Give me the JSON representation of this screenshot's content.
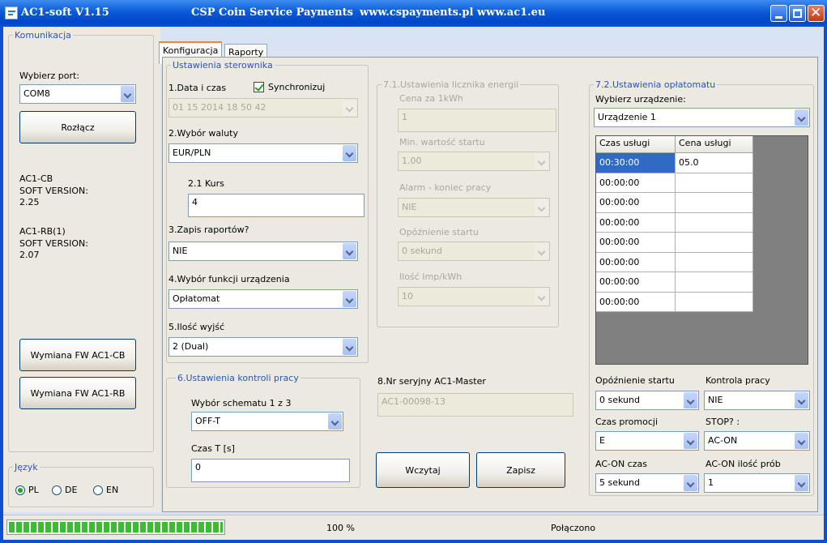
{
  "titlebar": {
    "app": "AC1-soft V1.15",
    "company": "CSP Coin Service Payments",
    "urls": "www.cspayments.pl  www.ac1.eu"
  },
  "komunikacja": {
    "group_title": "Komunikacja",
    "port_label": "Wybierz port:",
    "port_value": "COM8",
    "disconnect": "Rozłącz",
    "dev1_name": "AC1-CB",
    "dev1_soft": "SOFT VERSION:",
    "dev1_version": "2.25",
    "dev2_name": "AC1-RB(1)",
    "dev2_soft": "SOFT VERSION:",
    "dev2_version": "2.07",
    "fw_cb": "Wymiana FW AC1-CB",
    "fw_rb": "Wymiana FW AC1-RB"
  },
  "jezyk": {
    "group_title": "Język",
    "options": [
      "PL",
      "DE",
      "EN"
    ],
    "selected": "PL"
  },
  "tabs": [
    "Konfiguracja",
    "Raporty"
  ],
  "sterownik": {
    "group_title": "Ustawienia sterownika",
    "date_label": "1.Data i czas",
    "sync_label": "Synchronizuj",
    "sync_checked": true,
    "date_value": "01 15 2014 18 50 42",
    "currency_label": "2.Wybór waluty",
    "currency_value": "EUR/PLN",
    "rate_label": "2.1 Kurs",
    "rate_value": "4",
    "reports_label": "3.Zapis raportów?",
    "reports_value": "NIE",
    "function_label": "4.Wybór funkcji urządzenia",
    "function_value": "Opłatomat",
    "outputs_label": "5.Ilość wyjść",
    "outputs_value": "2  (Dual)"
  },
  "kontrola": {
    "group_title": "6.Ustawienia kontroli pracy",
    "schema_label": "Wybór schematu 1 z 3",
    "schema_value": "OFF-T",
    "time_label": "Czas T [s]",
    "time_value": "0"
  },
  "licznik": {
    "group_title": "7.1.Ustawienia licznika energii",
    "price_label": "Cena za 1kWh",
    "price_value": "1",
    "min_label": "Min. wartość startu",
    "min_value": "1.00",
    "alarm_label": "Alarm - koniec pracy",
    "alarm_value": "NIE",
    "delay_label": "Opóźnienie startu",
    "delay_value": "0 sekund",
    "imp_label": "Ilość Imp/kWh",
    "imp_value": "10"
  },
  "serial": {
    "label": "8.Nr seryjny AC1-Master",
    "value": "AC1-00098-13"
  },
  "buttons": {
    "load": "Wczytaj",
    "save": "Zapisz"
  },
  "oplatomat": {
    "group_title": "7.2.Ustawienia opłatomatu",
    "device_label": "Wybierz urządzenie:",
    "device_value": "Urządzenie 1",
    "table_headers": [
      "Czas usługi",
      "Cena usługi"
    ],
    "rows": [
      [
        "00:30:00",
        "05.0"
      ],
      [
        "00:00:00",
        ""
      ],
      [
        "00:00:00",
        ""
      ],
      [
        "00:00:00",
        ""
      ],
      [
        "00:00:00",
        ""
      ],
      [
        "00:00:00",
        ""
      ],
      [
        "00:00:00",
        ""
      ],
      [
        "00:00:00",
        ""
      ]
    ],
    "delay_label": "Opóźnienie startu",
    "delay_value": "0 sekund",
    "work_label": "Kontrola pracy",
    "work_value": "NIE",
    "promo_label": "Czas promocji",
    "promo_value": "E",
    "stop_label": "STOP? :",
    "stop_value": "AC-ON",
    "acon_time_label": "AC-ON czas",
    "acon_time_value": "5 sekund",
    "acon_tries_label": "AC-ON ilość prób",
    "acon_tries_value": "1"
  },
  "status": {
    "progress": 100,
    "percent_text": "100 %",
    "state": "Połączono"
  }
}
